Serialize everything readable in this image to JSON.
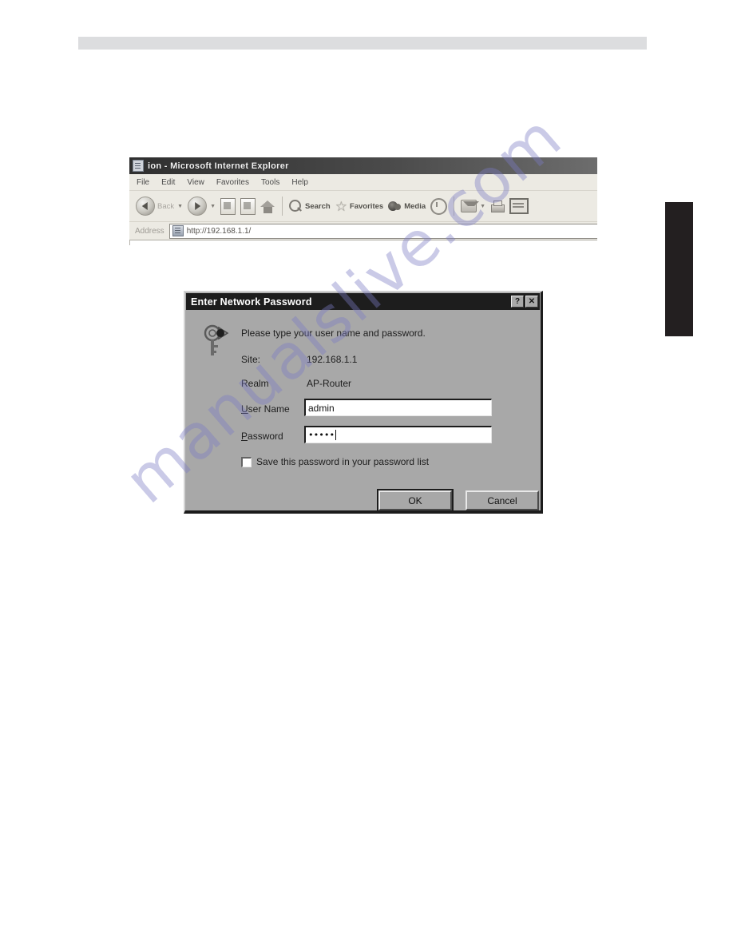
{
  "page": {
    "header_strip": "",
    "section_tab": ""
  },
  "watermark": {
    "text": "manualslive.com",
    "color": "#7b7ac4"
  },
  "browser": {
    "title": "ion - Microsoft Internet Explorer",
    "menu": [
      {
        "label": "File"
      },
      {
        "label": "Edit"
      },
      {
        "label": "View"
      },
      {
        "label": "Favorites"
      },
      {
        "label": "Tools"
      },
      {
        "label": "Help"
      }
    ],
    "toolbar": [
      {
        "label": "Back",
        "icon": "back-arrow-icon"
      },
      {
        "label": "",
        "icon": "forward-arrow-icon"
      },
      {
        "label": "",
        "icon": "stop-icon"
      },
      {
        "label": "",
        "icon": "refresh-icon"
      },
      {
        "label": "",
        "icon": "home-icon"
      },
      {
        "label": "Search",
        "icon": "search-icon"
      },
      {
        "label": "Favorites",
        "icon": "star-icon"
      },
      {
        "label": "Media",
        "icon": "media-icon"
      },
      {
        "label": "",
        "icon": "history-icon"
      },
      {
        "label": "",
        "icon": "mail-icon"
      },
      {
        "label": "",
        "icon": "print-icon"
      },
      {
        "label": "",
        "icon": "edit-icon"
      }
    ],
    "address": {
      "label": "Address",
      "value": "http://192.168.1.1/"
    }
  },
  "dialog": {
    "title": "Enter Network Password",
    "help_button": "?",
    "close_button": "✕",
    "prompt": "Please type your user name and password.",
    "site_label": "Site:",
    "site_value": "192.168.1.1",
    "realm_label": "Realm",
    "realm_value": "AP-Router",
    "username_label_accel": "U",
    "username_label_rest": "ser Name",
    "username_value": "admin",
    "password_label_accel": "P",
    "password_label_rest": "assword",
    "password_value": "•••••",
    "save_password_accel": "S",
    "save_password_rest": "ave this password in your password list",
    "save_password_checked": false,
    "ok_label": "OK",
    "cancel_label": "Cancel"
  }
}
